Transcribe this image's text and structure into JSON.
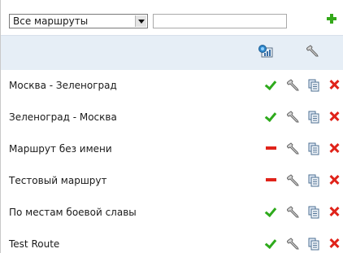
{
  "toolbar": {
    "route_filter": {
      "selected": "Все маршруты",
      "options_visible": [
        "Все маршруты"
      ]
    },
    "search": {
      "value": "",
      "placeholder": ""
    },
    "add_icon": "plus-icon"
  },
  "header": {
    "columns": [
      {
        "icon": "stats-icon"
      },
      {
        "icon": "wrench-icon"
      }
    ]
  },
  "routes": [
    {
      "name": "Москва - Зеленоград",
      "status": "active",
      "status_icon": "check-icon"
    },
    {
      "name": "Зеленоград - Москва",
      "status": "active",
      "status_icon": "check-icon"
    },
    {
      "name": "Маршрут без имени",
      "status": "inactive",
      "status_icon": "minus-icon"
    },
    {
      "name": "Тестовый маршрут",
      "status": "inactive",
      "status_icon": "minus-icon"
    },
    {
      "name": "По местам боевой славы",
      "status": "active",
      "status_icon": "check-icon"
    },
    {
      "name": "Test Route",
      "status": "active",
      "status_icon": "check-icon"
    }
  ],
  "row_actions": [
    "wrench-icon",
    "copy-icon",
    "delete-icon"
  ],
  "colors": {
    "header_bg": "#e6eef6",
    "ok_green": "#2eaa1c",
    "delete_red": "#e0231a",
    "add_green": "#34a81a"
  }
}
